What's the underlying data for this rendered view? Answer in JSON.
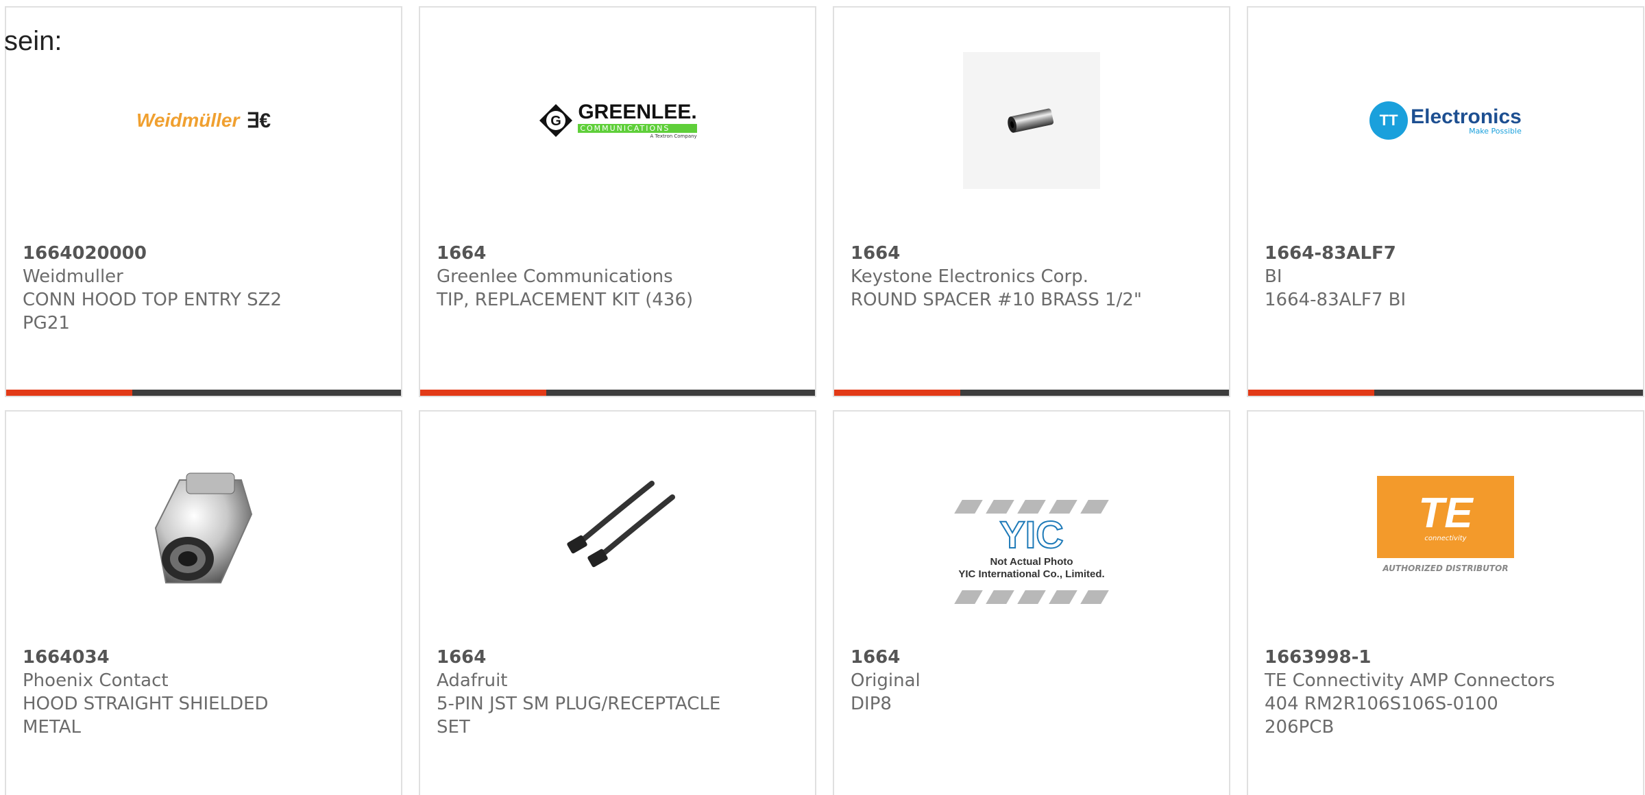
{
  "intro_text": "sein:",
  "colors": {
    "bar": "#3d3d3d",
    "accent": "#e23a17",
    "border": "#e0e0e0",
    "text": "#6b6b6b"
  },
  "products": [
    {
      "part_number": "1664020000",
      "manufacturer": "Weidmuller",
      "description": "CONN HOOD TOP ENTRY SZ2\nPG21",
      "image": {
        "type": "logo",
        "name": "weidmuller-logo",
        "text": "Weidmüller",
        "mark": "∃€"
      }
    },
    {
      "part_number": "1664",
      "manufacturer": "Greenlee Communications",
      "description": "TIP, REPLACEMENT KIT (436)",
      "image": {
        "type": "logo",
        "name": "greenlee-logo",
        "text": "GREENLEE.",
        "strip": "COMMUNICATIONS",
        "tiny": "A Textron Company"
      }
    },
    {
      "part_number": "1664",
      "manufacturer": "Keystone Electronics Corp.",
      "description": "ROUND SPACER #10 BRASS 1/2\"",
      "image": {
        "type": "photo",
        "name": "round-spacer-photo"
      }
    },
    {
      "part_number": "1664-83ALF7",
      "manufacturer": "BI",
      "description": "1664-83ALF7 BI",
      "image": {
        "type": "logo",
        "name": "tt-electronics-logo",
        "text": "Electronics",
        "mark": "TT",
        "tagline": "Make Possible"
      }
    },
    {
      "part_number": "1664034",
      "manufacturer": "Phoenix Contact",
      "description": "HOOD STRAIGHT SHIELDED\nMETAL",
      "image": {
        "type": "photo",
        "name": "metal-hood-photo"
      }
    },
    {
      "part_number": "1664",
      "manufacturer": "Adafruit",
      "description": "5-PIN JST SM PLUG/RECEPTACLE\nSET",
      "image": {
        "type": "photo",
        "name": "jst-cable-photo"
      }
    },
    {
      "part_number": "1664",
      "manufacturer": "Original",
      "description": "DIP8",
      "image": {
        "type": "placeholder",
        "name": "yic-placeholder-image",
        "mark": "YIC",
        "line1": "Not Actual Photo",
        "line2": "YIC International Co., Limited."
      }
    },
    {
      "part_number": "1663998-1",
      "manufacturer": "TE Connectivity AMP Connectors",
      "description": "404 RM2R106S106S-0100\n206PCB",
      "image": {
        "type": "logo",
        "name": "te-connectivity-logo",
        "text": "TE",
        "sub": "connectivity",
        "caption": "AUTHORIZED DISTRIBUTOR"
      }
    }
  ]
}
